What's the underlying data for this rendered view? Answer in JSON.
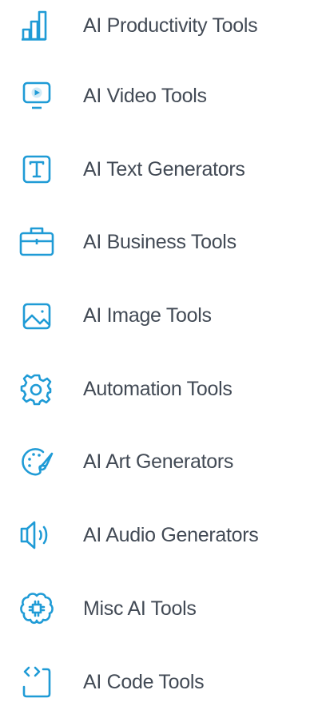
{
  "accent_color": "#1f9bd6",
  "text_color": "#424a55",
  "menu": {
    "items": [
      {
        "label": "AI Productivity Tools",
        "icon": "bar-chart-icon"
      },
      {
        "label": "AI Video Tools",
        "icon": "video-monitor-icon"
      },
      {
        "label": "AI Text Generators",
        "icon": "text-box-icon"
      },
      {
        "label": "AI Business Tools",
        "icon": "briefcase-icon"
      },
      {
        "label": "AI Image Tools",
        "icon": "image-icon"
      },
      {
        "label": "Automation Tools",
        "icon": "gear-icon"
      },
      {
        "label": "AI Art Generators",
        "icon": "palette-icon"
      },
      {
        "label": "AI Audio Generators",
        "icon": "speaker-icon"
      },
      {
        "label": "Misc AI Tools",
        "icon": "brain-chip-icon"
      },
      {
        "label": "AI Code Tools",
        "icon": "code-file-icon"
      }
    ]
  }
}
